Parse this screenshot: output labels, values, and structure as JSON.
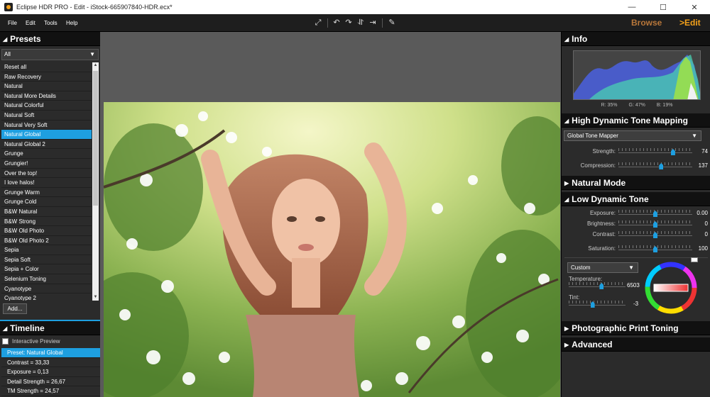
{
  "window": {
    "title": "Eclipse HDR PRO - Edit - iStock-665907840-HDR.ecx*",
    "controls": [
      "—",
      "☐",
      "✕"
    ]
  },
  "menu": [
    "File",
    "Edit",
    "Tools",
    "Help"
  ],
  "modes": {
    "browse": "Browse",
    "edit": ">Edit"
  },
  "presets": {
    "title": "Presets",
    "filter": "All",
    "items": [
      "Reset all",
      "Raw Recovery",
      "Natural",
      "Natural More Details",
      "Natural Colorful",
      "Natural Soft",
      "Natural Very Soft",
      "Natural Global",
      "Natural Global 2",
      "Grunge",
      "Grungier!",
      "Over the top!",
      "I love halos!",
      "Grunge Warm",
      "Grunge Cold",
      "B&W Natural",
      "B&W Strong",
      "B&W Old Photo",
      "B&W Old Photo 2",
      "Sepia",
      "Sepia Soft",
      "Sepia + Color",
      "Selenium Toning",
      "Cyanotype",
      "Cyanotype 2"
    ],
    "selected_index": 7,
    "add_label": "Add..."
  },
  "timeline": {
    "title": "Timeline",
    "interactive_preview": "Interactive Preview",
    "interactive_preview_checked": false,
    "items": [
      "Preset: Natural Global",
      "Contrast = 33,33",
      "Exposure = 0,13",
      "Detail Strength = 26,67",
      "TM Strength = 24,57"
    ],
    "selected_index": 0
  },
  "info": {
    "title": "Info",
    "r": "R: 35%",
    "g": "G: 47%",
    "b": "B: 19%"
  },
  "hdr": {
    "title": "High Dynamic Tone Mapping",
    "mapper": "Global Tone Mapper",
    "sliders": [
      {
        "label": "Strength:",
        "value": "74",
        "pos": 0.74
      },
      {
        "label": "Compression:",
        "value": "137",
        "pos": 0.58
      }
    ]
  },
  "natural_mode": {
    "title": "Natural Mode"
  },
  "ldt": {
    "title": "Low Dynamic Tone",
    "sliders": [
      {
        "label": "Exposure:",
        "value": "0.00",
        "pos": 0.5
      },
      {
        "label": "Brightness:",
        "value": "0",
        "pos": 0.5
      },
      {
        "label": "Contrast:",
        "value": "0",
        "pos": 0.5
      },
      {
        "label": "Saturation:",
        "value": "100",
        "pos": 0.5
      }
    ]
  },
  "white_balance": {
    "mode": "Custom",
    "temperature_label": "Temperature:",
    "temperature_value": "6503",
    "temperature_pos": 0.58,
    "tint_label": "Tint:",
    "tint_value": "-3",
    "tint_pos": 0.42
  },
  "photographic": {
    "title": "Photographic Print Toning"
  },
  "advanced": {
    "title": "Advanced"
  },
  "colors": {
    "accent": "#1e9fe0",
    "browse": "#b8773a",
    "edit": "#f5a21b"
  }
}
